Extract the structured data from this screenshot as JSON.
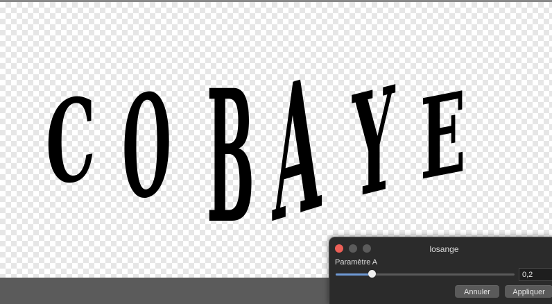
{
  "canvas": {
    "artwork_text": "COBAYE"
  },
  "dialog": {
    "title": "losange",
    "param_label": "Paramètre A",
    "slider_level": 0.2,
    "value": "0,2",
    "cancel_label": "Annuler",
    "apply_label": "Appliquer"
  },
  "colors": {
    "close": "#ec5f57",
    "slider_accent": "#6f9ad6",
    "artwork": "#000000"
  }
}
